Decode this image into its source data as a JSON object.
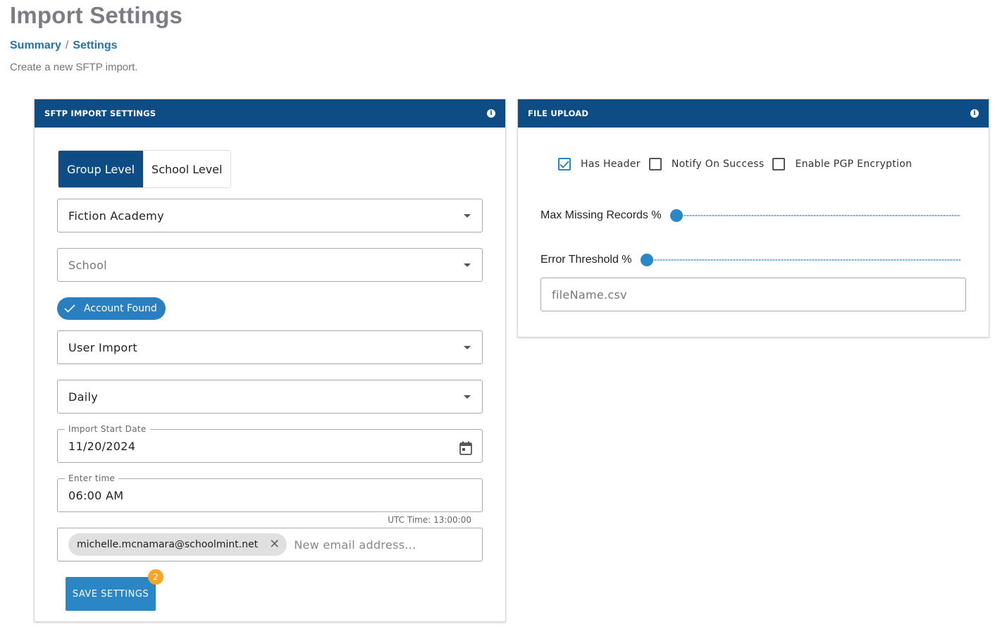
{
  "page": {
    "title": "Import Settings",
    "subtitle": "Create a new SFTP import."
  },
  "breadcrumb": {
    "items": [
      "Summary",
      "Settings"
    ],
    "separator": "/"
  },
  "sftp_card": {
    "title": "SFTP IMPORT SETTINGS",
    "level_toggle": {
      "options": [
        "Group Level",
        "School Level"
      ],
      "selected": "Group Level"
    },
    "group_select": {
      "value": "Fiction Academy"
    },
    "school_select": {
      "placeholder": "School"
    },
    "account_status": {
      "label": "Account Found"
    },
    "import_type_select": {
      "value": "User Import"
    },
    "frequency_select": {
      "value": "Daily"
    },
    "start_date": {
      "label": "Import Start Date",
      "value": "11/20/2024"
    },
    "time": {
      "label": "Enter time",
      "value": "06:00 AM"
    },
    "utc_time": "UTC Time: 13:00:00",
    "emails": {
      "chips": [
        "michelle.mcnamara@schoolmint.net"
      ],
      "placeholder": "New email address..."
    },
    "save_button": {
      "label": "SAVE SETTINGS",
      "badge": "2"
    }
  },
  "file_card": {
    "title": "FILE UPLOAD",
    "checkboxes": [
      {
        "label": "Has Header",
        "checked": true
      },
      {
        "label": "Notify On Success",
        "checked": false
      },
      {
        "label": "Enable PGP Encryption",
        "checked": false
      }
    ],
    "sliders": [
      {
        "label": "Max Missing Records %",
        "value": 0
      },
      {
        "label": "Error Threshold %",
        "value": 0
      }
    ],
    "file_name": {
      "placeholder": "fileName.csv"
    }
  },
  "colors": {
    "header_bg": "#0d4c84",
    "accent": "#2a86c5",
    "badge": "#f5a623",
    "title_gray": "#7a7e83",
    "link": "#1e73b7"
  }
}
